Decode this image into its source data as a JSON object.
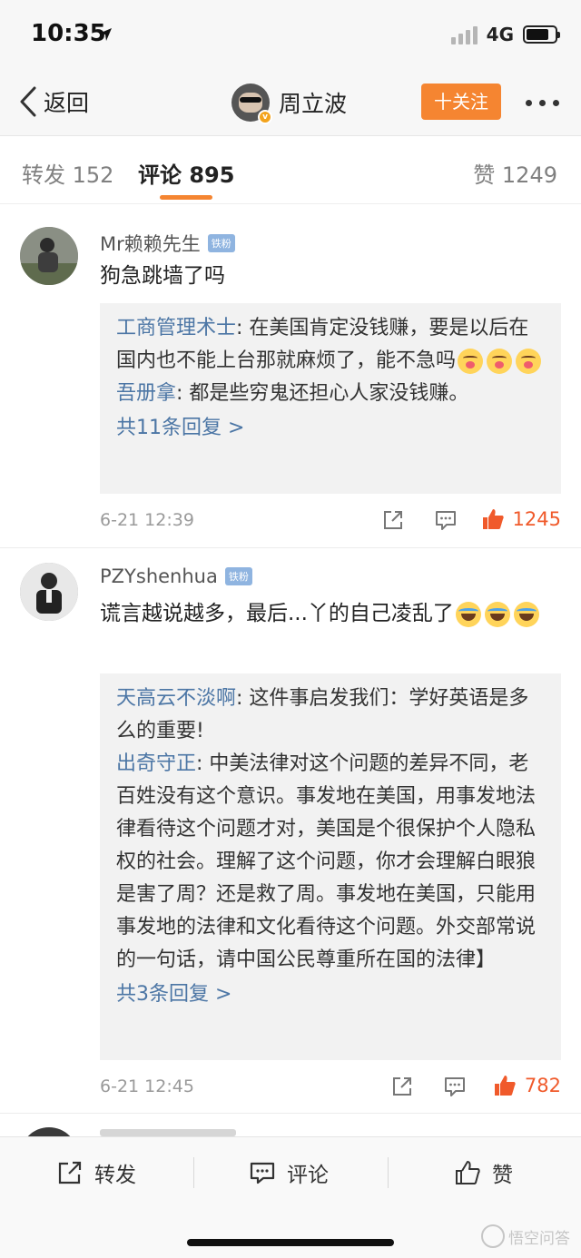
{
  "status": {
    "time": "10:35",
    "network": "4G"
  },
  "nav": {
    "back_label": "返回",
    "user_name": "周立波",
    "follow_label": "十关注"
  },
  "tabs": {
    "repost": "转发 152",
    "comments": "评论 895",
    "likes": "赞 1249"
  },
  "comments": [
    {
      "username": "Mr赖赖先生",
      "badge": "铁粉",
      "text": "狗急跳墙了吗",
      "replies": [
        {
          "name": "工商管理术士",
          "text": ": 在美国肯定没钱赚，要是以后在国内也不能上台那就麻烦了，能不急吗"
        },
        {
          "name": "吾册拿",
          "text": ": 都是些穷鬼还担心人家没钱赚。"
        }
      ],
      "more_replies": "共11条回复 >",
      "date": "6-21 12:39",
      "likes": "1245"
    },
    {
      "username": "PZYshenhua",
      "badge": "铁粉",
      "text": "谎言越说越多，最后...丫的自己凌乱了",
      "replies": [
        {
          "name": "天高云不淡啊",
          "text": ": 这件事启发我们：学好英语是多么的重要!"
        },
        {
          "name": "出奇守正",
          "text": ": 中美法律对这个问题的差异不同，老百姓没有这个意识。事发地在美国，用事发地法律看待这个问题才对，美国是个很保护个人隐私权的社会。理解了这个问题，你才会理解白眼狼是害了周？还是救了周。事发地在美国，只能用事发地的法律和文化看待这个问题。外交部常说的一句话，请中国公民尊重所在国的法律】"
        }
      ],
      "more_replies": "共3条回复 >",
      "date": "6-21 12:45",
      "likes": "782"
    }
  ],
  "bottom_bar": {
    "repost": "转发",
    "comment": "评论",
    "like": "赞"
  },
  "watermark": "悟空问答",
  "colors": {
    "accent": "#f58531",
    "link": "#4c76a5",
    "like": "#f05a2b"
  }
}
